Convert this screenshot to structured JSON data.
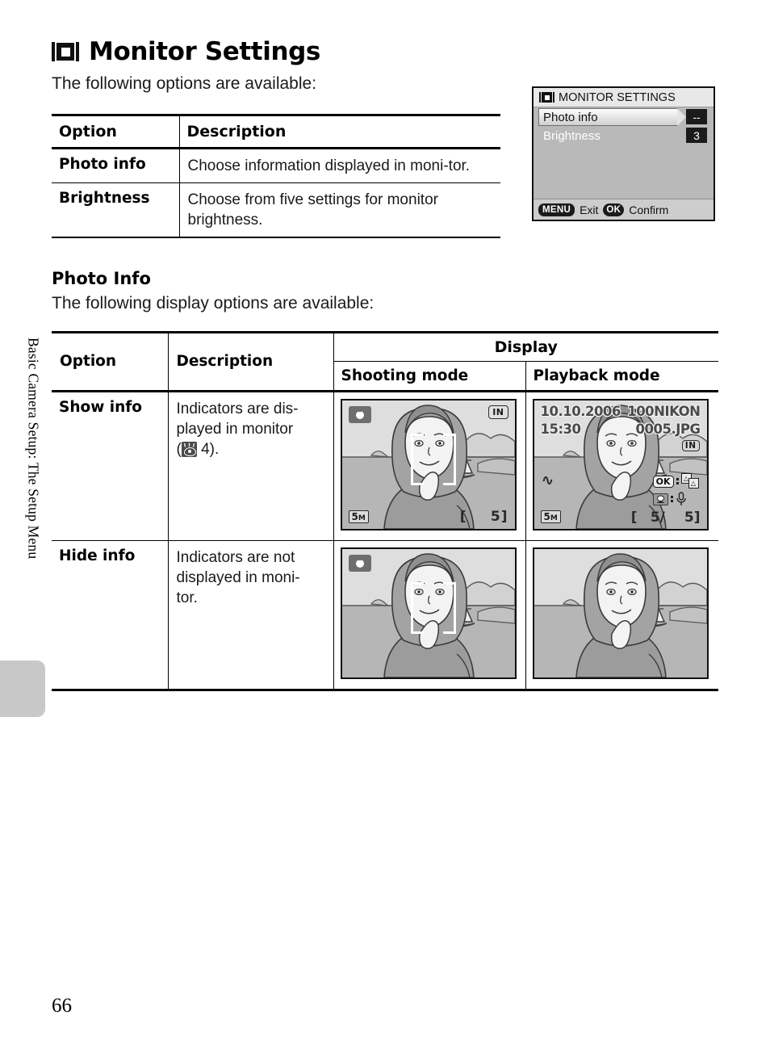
{
  "sidebar": {
    "vertical_label": "Basic Camera Setup: The Setup Menu"
  },
  "page": {
    "title": "Monitor Settings",
    "title_icon": "monitor-icon",
    "intro_1": "The following options are available:",
    "section_heading": "Photo Info",
    "intro_2": "The following display options are available:",
    "page_number": "66"
  },
  "camera_menu": {
    "icon": "monitor-icon",
    "title": "MONITOR SETTINGS",
    "rows": [
      {
        "label": "Photo info",
        "value": "--",
        "selected": true
      },
      {
        "label": "Brightness",
        "value": "3",
        "selected": false
      }
    ],
    "footer": {
      "menu_key": "MENU",
      "menu_action": "Exit",
      "ok_key": "OK",
      "ok_action": "Confirm"
    }
  },
  "options_table": {
    "headers": [
      "Option",
      "Description"
    ],
    "rows": [
      {
        "option": "Photo info",
        "description": "Choose information displayed in moni-tor."
      },
      {
        "option": "Brightness",
        "description": "Choose from five settings for monitor brightness."
      }
    ]
  },
  "display_table": {
    "header_option": "Option",
    "header_description": "Description",
    "header_display": "Display",
    "header_shooting": "Shooting mode",
    "header_playback": "Playback mode",
    "rows": [
      {
        "option": "Show info",
        "description_line1": "Indicators are dis-",
        "description_line2": "played in monitor",
        "description_prefix": "(",
        "description_ref_icon": "reference-eye-icon",
        "description_page": " 4).",
        "shooting": {
          "indicators": true,
          "mode_icon": "camera-icon",
          "memory": "IN",
          "image_size": "5",
          "image_size_unit": "M",
          "bracket": "[",
          "frames": "5]"
        },
        "playback": {
          "indicators": true,
          "date": "10.10.2006",
          "time": "15:30",
          "folder": "100NIKON",
          "file": "0005.JPG",
          "memory": "IN",
          "wave_icon": "dscene-icon",
          "image_size": "5",
          "image_size_unit": "M",
          "ok_key": "OK",
          "crop_icon": "crop-icon",
          "resize_icon": "small-picture-icon",
          "dscene_icon": "d-lighting-icon",
          "voice_icon": "microphone-icon",
          "bracket": "[",
          "counter_current": "5/",
          "counter_total": "5]"
        }
      },
      {
        "option": "Hide info",
        "description_line1": "Indicators are not",
        "description_line2": "displayed in moni-",
        "description_line3": "tor.",
        "shooting": {
          "indicators": false,
          "mode_icon": "camera-icon"
        },
        "playback": {
          "indicators": false
        }
      }
    ]
  },
  "colors": {
    "ink": "#000000",
    "tab_gray": "#c8c8c8",
    "menu_bg": "#b9b9b9",
    "menu_title_bg": "#e8e8e8",
    "screen_sky": "#dcdcdc",
    "screen_sea": "#b4b4b4"
  }
}
